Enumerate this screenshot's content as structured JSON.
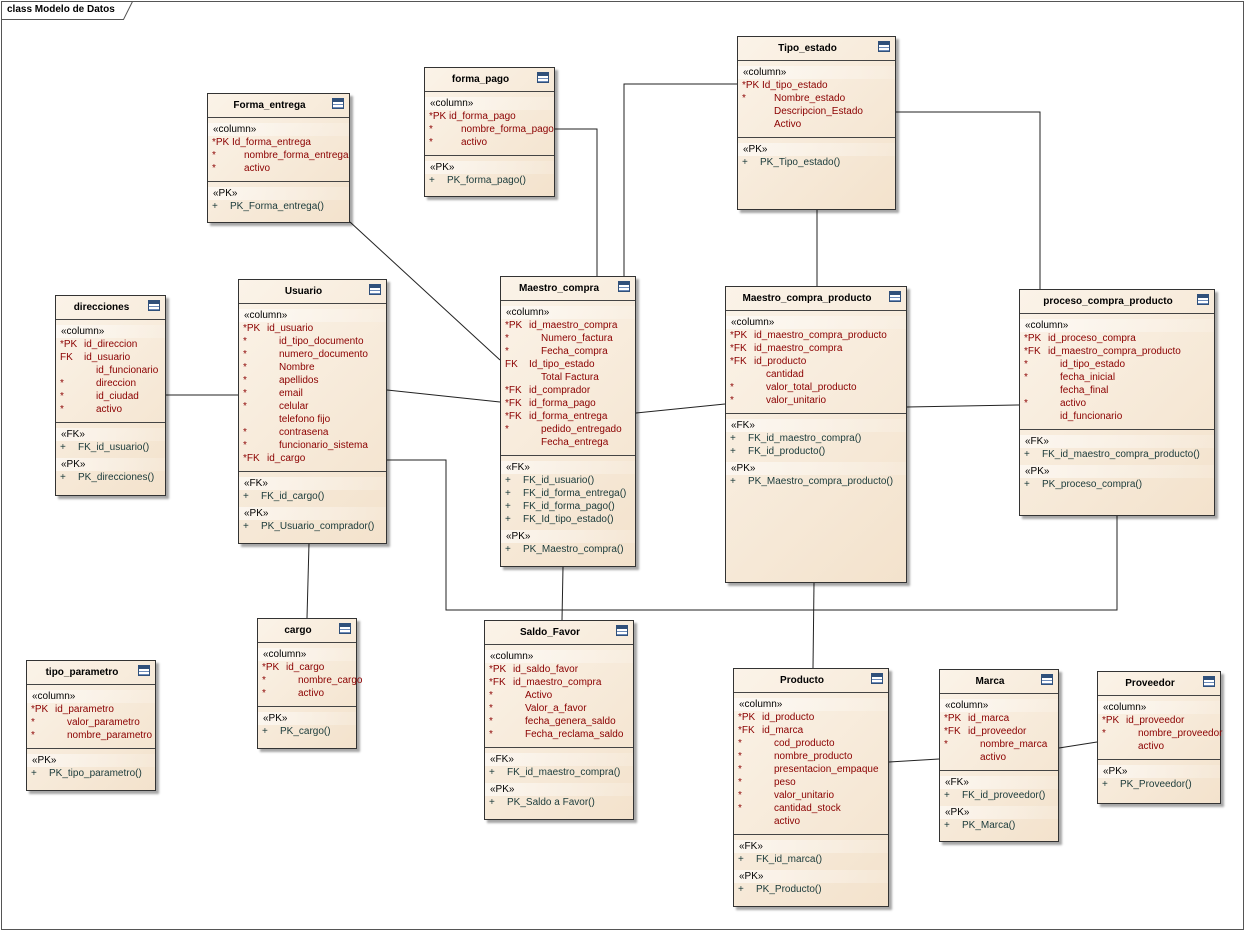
{
  "frame": {
    "title": "class Modelo de Datos"
  },
  "classes": [
    {
      "name": "Forma_entrega",
      "sections": [
        {
          "groups": [
            {
              "stereo": "«column»",
              "rows": [
                {
                  "prefix": "*PK",
                  "text": "Id_forma_entrega"
                },
                {
                  "prefix": "*",
                  "text": "nombre_forma_entrega"
                },
                {
                  "prefix": "*",
                  "text": "activo"
                }
              ]
            }
          ]
        },
        {
          "op": true,
          "groups": [
            {
              "stereo": "«PK»",
              "rows": [
                {
                  "prefix": "+",
                  "text": "PK_Forma_entrega()"
                }
              ]
            }
          ]
        }
      ]
    },
    {
      "name": "forma_pago",
      "sections": [
        {
          "groups": [
            {
              "stereo": "«column»",
              "rows": [
                {
                  "prefix": "*PK",
                  "text": "id_forma_pago"
                },
                {
                  "prefix": "*",
                  "text": "nombre_forma_pago"
                },
                {
                  "prefix": "*",
                  "text": "activo"
                }
              ]
            }
          ]
        },
        {
          "op": true,
          "groups": [
            {
              "stereo": "«PK»",
              "rows": [
                {
                  "prefix": "+",
                  "text": "PK_forma_pago()"
                }
              ]
            }
          ]
        }
      ]
    },
    {
      "name": "Tipo_estado",
      "sections": [
        {
          "groups": [
            {
              "stereo": "«column»",
              "rows": [
                {
                  "prefix": "*PK",
                  "text": "Id_tipo_estado"
                },
                {
                  "prefix": "*",
                  "text": "Nombre_estado"
                },
                {
                  "prefix": "",
                  "text": "Descripcion_Estado"
                },
                {
                  "prefix": "",
                  "text": "Activo"
                }
              ]
            }
          ]
        },
        {
          "op": true,
          "groups": [
            {
              "stereo": "«PK»",
              "rows": [
                {
                  "prefix": "+",
                  "text": "PK_Tipo_estado()"
                }
              ]
            }
          ]
        }
      ]
    },
    {
      "name": "direcciones",
      "sections": [
        {
          "groups": [
            {
              "stereo": "«column»",
              "rows": [
                {
                  "prefix": "*PK",
                  "text": "id_direccion"
                },
                {
                  "prefix": "FK",
                  "text": "id_usuario"
                },
                {
                  "prefix": "",
                  "text": "id_funcionario"
                },
                {
                  "prefix": "*",
                  "text": "direccion"
                },
                {
                  "prefix": "*",
                  "text": "id_ciudad"
                },
                {
                  "prefix": "*",
                  "text": "activo"
                }
              ]
            }
          ]
        },
        {
          "op": true,
          "groups": [
            {
              "stereo": "«FK»",
              "rows": [
                {
                  "prefix": "+",
                  "text": "FK_id_usuario()"
                }
              ]
            },
            {
              "stereo": "«PK»",
              "rows": [
                {
                  "prefix": "+",
                  "text": "PK_direcciones()"
                }
              ]
            }
          ]
        }
      ]
    },
    {
      "name": "Usuario",
      "sections": [
        {
          "groups": [
            {
              "stereo": "«column»",
              "rows": [
                {
                  "prefix": "*PK",
                  "text": "id_usuario"
                },
                {
                  "prefix": "*",
                  "text": "id_tipo_documento"
                },
                {
                  "prefix": "*",
                  "text": "numero_documento"
                },
                {
                  "prefix": "*",
                  "text": "Nombre"
                },
                {
                  "prefix": "*",
                  "text": "apellidos"
                },
                {
                  "prefix": "*",
                  "text": "email"
                },
                {
                  "prefix": "*",
                  "text": "celular"
                },
                {
                  "prefix": "",
                  "text": "telefono fijo"
                },
                {
                  "prefix": "*",
                  "text": "contrasena"
                },
                {
                  "prefix": "*",
                  "text": "funcionario_sistema"
                },
                {
                  "prefix": "*FK",
                  "text": "id_cargo"
                }
              ]
            }
          ]
        },
        {
          "op": true,
          "groups": [
            {
              "stereo": "«FK»",
              "rows": [
                {
                  "prefix": "+",
                  "text": "FK_id_cargo()"
                }
              ]
            },
            {
              "stereo": "«PK»",
              "rows": [
                {
                  "prefix": "+",
                  "text": "PK_Usuario_comprador()"
                }
              ]
            }
          ]
        }
      ]
    },
    {
      "name": "Maestro_compra",
      "sections": [
        {
          "groups": [
            {
              "stereo": "«column»",
              "rows": [
                {
                  "prefix": "*PK",
                  "text": "id_maestro_compra"
                },
                {
                  "prefix": "*",
                  "text": "Numero_factura"
                },
                {
                  "prefix": "*",
                  "text": "Fecha_compra"
                },
                {
                  "prefix": "FK",
                  "text": "Id_tipo_estado"
                },
                {
                  "prefix": "",
                  "text": "Total Factura"
                },
                {
                  "prefix": "*FK",
                  "text": "id_comprador"
                },
                {
                  "prefix": "*FK",
                  "text": "id_forma_pago"
                },
                {
                  "prefix": "*FK",
                  "text": "id_forma_entrega"
                },
                {
                  "prefix": "*",
                  "text": "pedido_entregado"
                },
                {
                  "prefix": "",
                  "text": "Fecha_entrega"
                }
              ]
            }
          ]
        },
        {
          "op": true,
          "groups": [
            {
              "stereo": "«FK»",
              "rows": [
                {
                  "prefix": "+",
                  "text": "FK_id_usuario()"
                },
                {
                  "prefix": "+",
                  "text": "FK_id_forma_entrega()"
                },
                {
                  "prefix": "+",
                  "text": "FK_id_forma_pago()"
                },
                {
                  "prefix": "+",
                  "text": "FK_Id_tipo_estado()"
                }
              ]
            },
            {
              "stereo": "«PK»",
              "rows": [
                {
                  "prefix": "+",
                  "text": "PK_Maestro_compra()"
                }
              ]
            }
          ]
        }
      ]
    },
    {
      "name": "Maestro_compra_producto",
      "sections": [
        {
          "groups": [
            {
              "stereo": "«column»",
              "rows": [
                {
                  "prefix": "*PK",
                  "text": "id_maestro_compra_producto"
                },
                {
                  "prefix": "*FK",
                  "text": "id_maestro_compra"
                },
                {
                  "prefix": "*FK",
                  "text": "id_producto"
                },
                {
                  "prefix": "",
                  "text": "cantidad"
                },
                {
                  "prefix": "*",
                  "text": "valor_total_producto"
                },
                {
                  "prefix": "*",
                  "text": "valor_unitario"
                }
              ]
            }
          ]
        },
        {
          "op": true,
          "groups": [
            {
              "stereo": "«FK»",
              "rows": [
                {
                  "prefix": "+",
                  "text": "FK_id_maestro_compra()"
                },
                {
                  "prefix": "+",
                  "text": "FK_id_producto()"
                }
              ]
            },
            {
              "stereo": "«PK»",
              "rows": [
                {
                  "prefix": "+",
                  "text": "PK_Maestro_compra_producto()"
                }
              ]
            }
          ]
        }
      ]
    },
    {
      "name": "proceso_compra_producto",
      "sections": [
        {
          "groups": [
            {
              "stereo": "«column»",
              "rows": [
                {
                  "prefix": "*PK",
                  "text": "id_proceso_compra"
                },
                {
                  "prefix": "*FK",
                  "text": "id_maestro_compra_producto"
                },
                {
                  "prefix": "*",
                  "text": "id_tipo_estado"
                },
                {
                  "prefix": "*",
                  "text": "fecha_inicial"
                },
                {
                  "prefix": "",
                  "text": "fecha_final"
                },
                {
                  "prefix": "*",
                  "text": "activo"
                },
                {
                  "prefix": "",
                  "text": "id_funcionario"
                }
              ]
            }
          ]
        },
        {
          "op": true,
          "groups": [
            {
              "stereo": "«FK»",
              "rows": [
                {
                  "prefix": "+",
                  "text": "FK_id_maestro_compra_producto()"
                }
              ]
            },
            {
              "stereo": "«PK»",
              "rows": [
                {
                  "prefix": "+",
                  "text": "PK_proceso_compra()"
                }
              ]
            }
          ]
        }
      ]
    },
    {
      "name": "cargo",
      "sections": [
        {
          "groups": [
            {
              "stereo": "«column»",
              "rows": [
                {
                  "prefix": "*PK",
                  "text": "id_cargo"
                },
                {
                  "prefix": "*",
                  "text": "nombre_cargo"
                },
                {
                  "prefix": "*",
                  "text": "activo"
                }
              ]
            }
          ]
        },
        {
          "op": true,
          "groups": [
            {
              "stereo": "«PK»",
              "rows": [
                {
                  "prefix": "+",
                  "text": "PK_cargo()"
                }
              ]
            }
          ]
        }
      ]
    },
    {
      "name": "Saldo_Favor",
      "sections": [
        {
          "groups": [
            {
              "stereo": "«column»",
              "rows": [
                {
                  "prefix": "*PK",
                  "text": "id_saldo_favor"
                },
                {
                  "prefix": "*FK",
                  "text": "id_maestro_compra"
                },
                {
                  "prefix": "*",
                  "text": "Activo"
                },
                {
                  "prefix": "*",
                  "text": "Valor_a_favor"
                },
                {
                  "prefix": "*",
                  "text": "fecha_genera_saldo"
                },
                {
                  "prefix": "*",
                  "text": "Fecha_reclama_saldo"
                }
              ]
            }
          ]
        },
        {
          "op": true,
          "groups": [
            {
              "stereo": "«FK»",
              "rows": [
                {
                  "prefix": "+",
                  "text": "FK_id_maestro_compra()"
                }
              ]
            },
            {
              "stereo": "«PK»",
              "rows": [
                {
                  "prefix": "+",
                  "text": "PK_Saldo a Favor()"
                }
              ]
            }
          ]
        }
      ]
    },
    {
      "name": "tipo_parametro",
      "sections": [
        {
          "groups": [
            {
              "stereo": "«column»",
              "rows": [
                {
                  "prefix": "*PK",
                  "text": "id_parametro"
                },
                {
                  "prefix": "*",
                  "text": "valor_parametro"
                },
                {
                  "prefix": "*",
                  "text": "nombre_parametro"
                }
              ]
            }
          ]
        },
        {
          "op": true,
          "groups": [
            {
              "stereo": "«PK»",
              "rows": [
                {
                  "prefix": "+",
                  "text": "PK_tipo_parametro()"
                }
              ]
            }
          ]
        }
      ]
    },
    {
      "name": "Producto",
      "sections": [
        {
          "groups": [
            {
              "stereo": "«column»",
              "rows": [
                {
                  "prefix": "*PK",
                  "text": "id_producto"
                },
                {
                  "prefix": "*FK",
                  "text": "id_marca"
                },
                {
                  "prefix": "*",
                  "text": "cod_producto"
                },
                {
                  "prefix": "*",
                  "text": "nombre_producto"
                },
                {
                  "prefix": "*",
                  "text": "presentacion_empaque"
                },
                {
                  "prefix": "*",
                  "text": "peso"
                },
                {
                  "prefix": "*",
                  "text": "valor_unitario"
                },
                {
                  "prefix": "*",
                  "text": "cantidad_stock"
                },
                {
                  "prefix": "",
                  "text": "activo"
                }
              ]
            }
          ]
        },
        {
          "op": true,
          "groups": [
            {
              "stereo": "«FK»",
              "rows": [
                {
                  "prefix": "+",
                  "text": "FK_id_marca()"
                }
              ]
            },
            {
              "stereo": "«PK»",
              "rows": [
                {
                  "prefix": "+",
                  "text": "PK_Producto()"
                }
              ]
            }
          ]
        }
      ]
    },
    {
      "name": "Marca",
      "sections": [
        {
          "groups": [
            {
              "stereo": "«column»",
              "rows": [
                {
                  "prefix": "*PK",
                  "text": "id_marca"
                },
                {
                  "prefix": "*FK",
                  "text": "id_proveedor"
                },
                {
                  "prefix": "*",
                  "text": "nombre_marca"
                },
                {
                  "prefix": "",
                  "text": "activo"
                }
              ]
            }
          ]
        },
        {
          "op": true,
          "groups": [
            {
              "stereo": "«FK»",
              "rows": [
                {
                  "prefix": "+",
                  "text": "FK_id_proveedor()"
                }
              ]
            },
            {
              "stereo": "«PK»",
              "rows": [
                {
                  "prefix": "+",
                  "text": "PK_Marca()"
                }
              ]
            }
          ]
        }
      ]
    },
    {
      "name": "Proveedor",
      "sections": [
        {
          "groups": [
            {
              "stereo": "«column»",
              "rows": [
                {
                  "prefix": "*PK",
                  "text": "id_proveedor"
                },
                {
                  "prefix": "*",
                  "text": "nombre_proveedor"
                },
                {
                  "prefix": "",
                  "text": "activo"
                }
              ]
            }
          ]
        },
        {
          "op": true,
          "groups": [
            {
              "stereo": "«PK»",
              "rows": [
                {
                  "prefix": "+",
                  "text": "PK_Proveedor()"
                }
              ]
            }
          ]
        }
      ]
    }
  ]
}
